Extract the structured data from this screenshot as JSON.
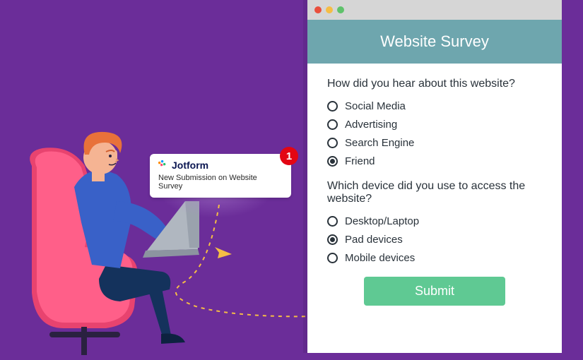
{
  "survey": {
    "header": "Website Survey",
    "q1": {
      "text": "How did you hear about this website?",
      "options": [
        "Social Media",
        "Advertising",
        "Search Engine",
        "Friend"
      ],
      "selected": 3
    },
    "q2": {
      "text": "Which device did you use to access the website?",
      "options": [
        "Desktop/Laptop",
        "Pad devices",
        "Mobile devices"
      ],
      "selected": 1
    },
    "submit": "Submit"
  },
  "notification": {
    "brand": "Jotform",
    "message": "New Submission on Website Survey",
    "badge": "1"
  }
}
